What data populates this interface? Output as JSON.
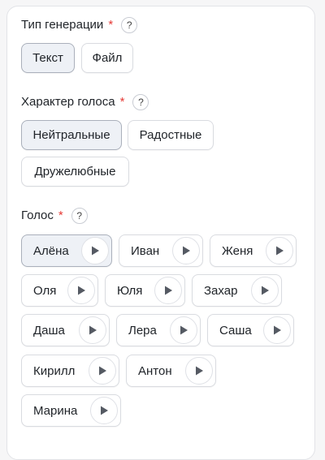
{
  "generation": {
    "title": "Тип генерации",
    "required_mark": "*",
    "help": "?",
    "options": [
      "Текст",
      "Файл"
    ],
    "selected": "Текст"
  },
  "character": {
    "title": "Характер голоса",
    "required_mark": "*",
    "help": "?",
    "options": [
      "Нейтральные",
      "Радостные",
      "Дружелюбные"
    ],
    "selected": "Нейтральные"
  },
  "voice": {
    "title": "Голос",
    "required_mark": "*",
    "help": "?",
    "options": [
      "Алёна",
      "Иван",
      "Женя",
      "Оля",
      "Юля",
      "Захар",
      "Даша",
      "Лера",
      "Саша",
      "Кирилл",
      "Антон",
      "Марина"
    ],
    "selected": "Алёна",
    "play_icon": "play-icon"
  },
  "colors": {
    "required": "#e53935",
    "selected_bg": "#eef1f6",
    "play": "#555a63"
  }
}
